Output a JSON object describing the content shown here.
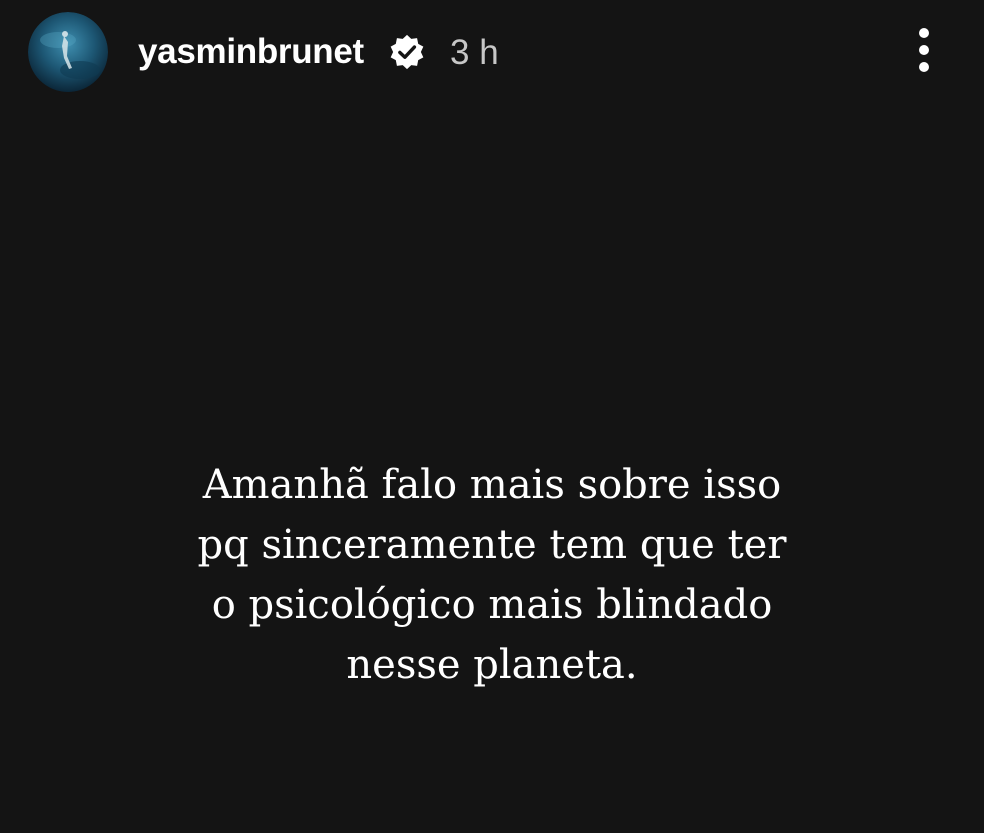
{
  "header": {
    "username": "yasminbrunet",
    "verified": true,
    "time_ago": "3 h",
    "avatar_icon": "profile-photo-underwater",
    "more_icon": "more-vertical-icon"
  },
  "story": {
    "text_lines": [
      "Amanhã falo mais sobre isso",
      "pq sinceramente tem que ter",
      "o psicológico mais blindado",
      "nesse planeta."
    ],
    "background_color": "#141414",
    "text_color": "#ffffff"
  }
}
